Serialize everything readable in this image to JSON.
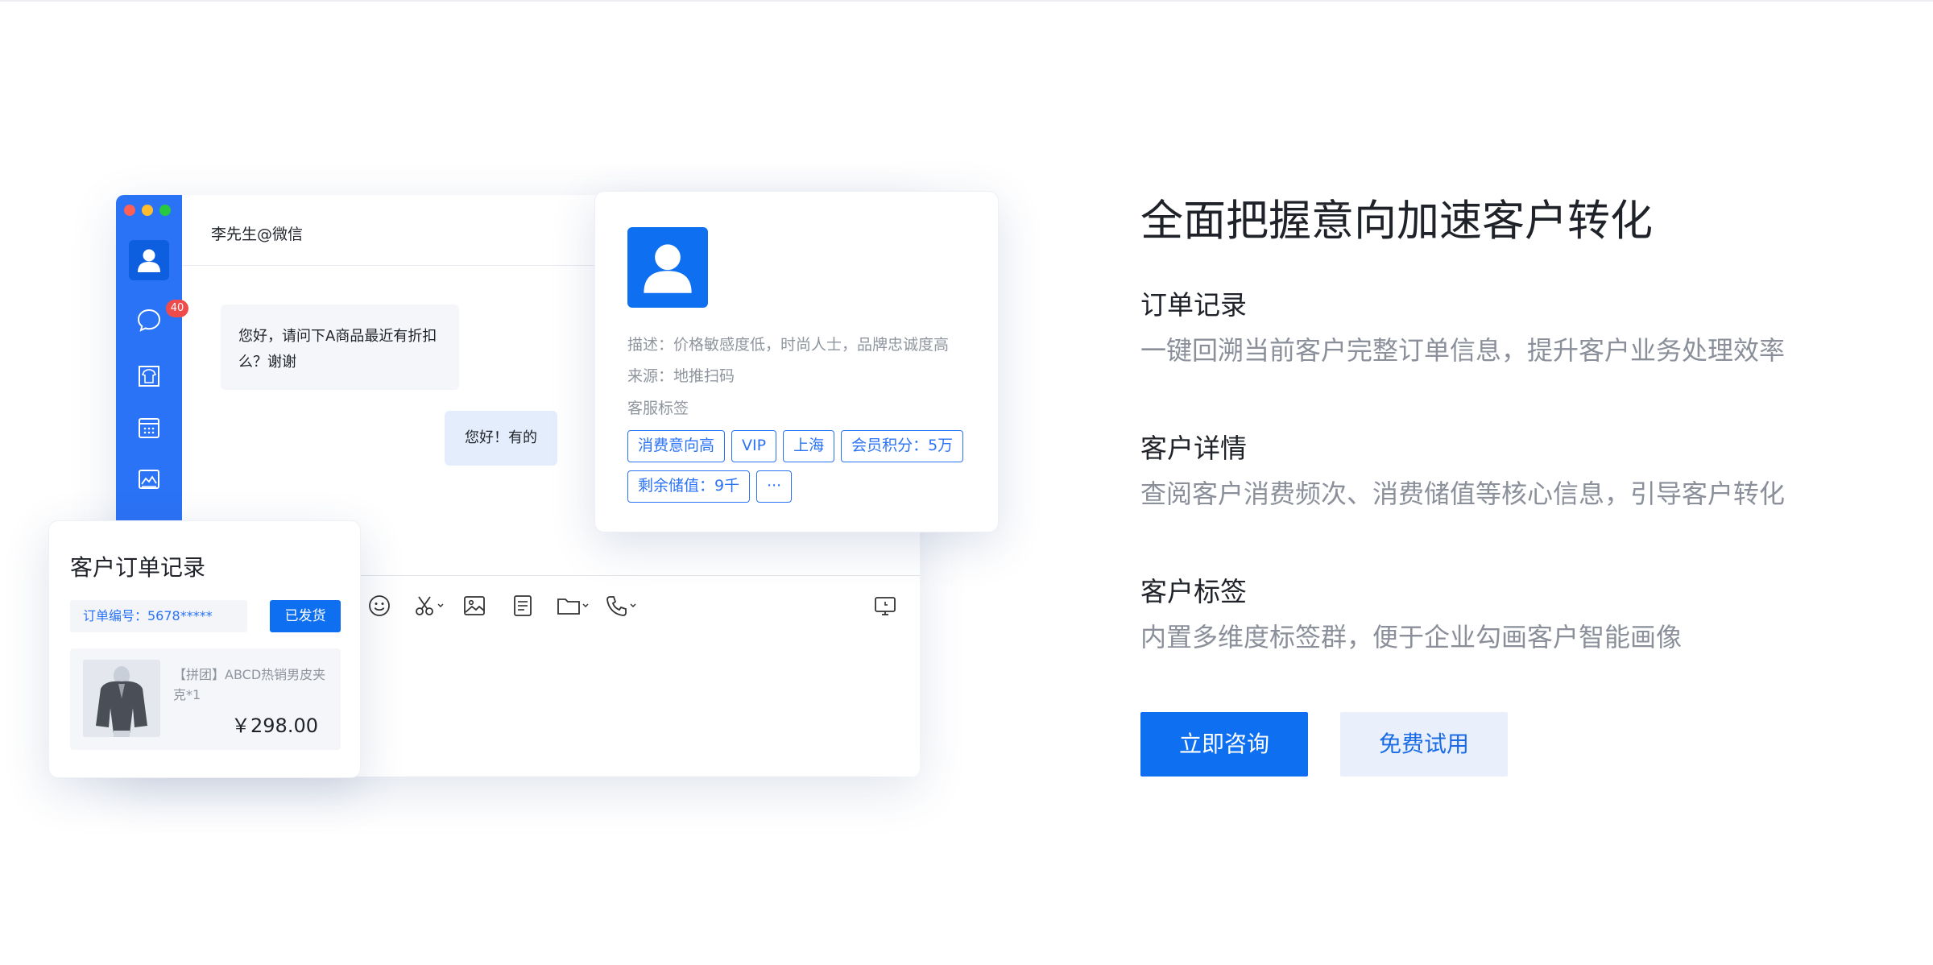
{
  "chat_window": {
    "contact_title": "李先生@微信",
    "unread_badge": "40",
    "message_in": "您好，请问下A商品最近有折扣么？谢谢",
    "message_out": "您好！有的"
  },
  "profile_card": {
    "description": "描述：价格敏感度低，时尚人士，品牌忠诚度高",
    "source": "来源：地推扫码",
    "tags_label": "客服标签",
    "tags": [
      "消费意向高",
      "VIP",
      "上海",
      "会员积分：5万",
      "剩余储值：9千",
      "···"
    ]
  },
  "order_card": {
    "title": "客户订单记录",
    "order_number": "订单编号：5678*****",
    "status_button": "已发货",
    "item_name": "【拼团】ABCD热销男皮夹克*1",
    "item_price": "￥298.00"
  },
  "content": {
    "heading": "全面把握意向加速客户转化",
    "features": [
      {
        "title": "订单记录",
        "description": "一键回溯当前客户完整订单信息，提升客户业务处理效率"
      },
      {
        "title": "客户详情",
        "description": "查阅客户消费频次、消费储值等核心信息，引导客户转化"
      },
      {
        "title": "客户标签",
        "description": "内置多维度标签群，便于企业勾画客户智能画像"
      }
    ],
    "primary_button": "立即咨询",
    "secondary_button": "免费试用"
  },
  "colors": {
    "brand_blue": "#0e6ff1",
    "sidebar_blue": "#2b73f6",
    "badge_red": "#f04b4b"
  },
  "icons": [
    "user-icon",
    "chat-icon",
    "shirt-icon",
    "calendar-icon",
    "image-icon",
    "emoji-icon",
    "scissors-icon",
    "picture-icon",
    "document-icon",
    "folder-icon",
    "phone-icon",
    "screen-icon"
  ]
}
